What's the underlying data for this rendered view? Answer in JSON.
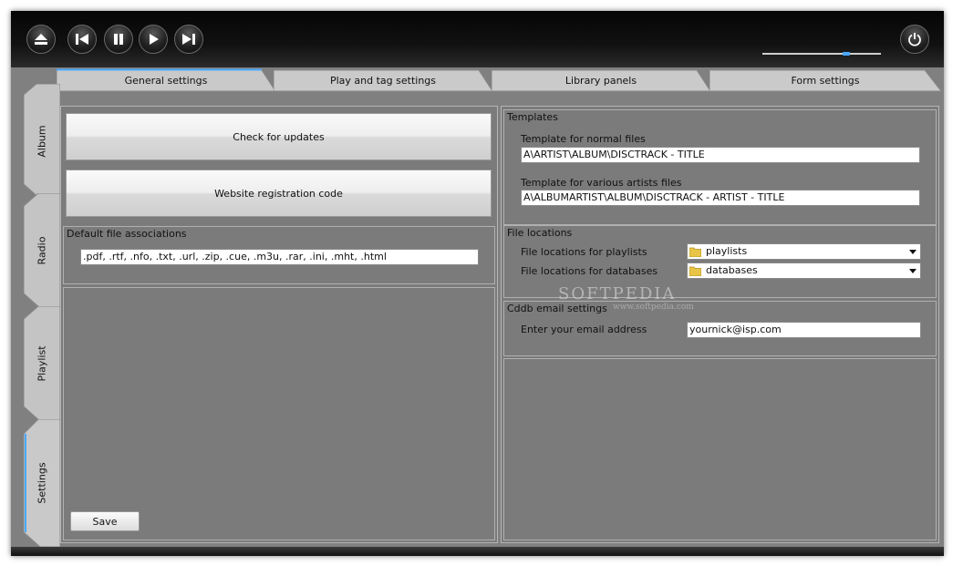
{
  "colors": {
    "accent": "#4aa8ff",
    "chrome": "#0c0c0c",
    "content_bg": "#7b7b7b",
    "button_face": "#ececec"
  },
  "transport": {
    "buttons": [
      {
        "name": "eject",
        "icon": "eject-icon"
      },
      {
        "name": "previous",
        "icon": "skip-back-icon"
      },
      {
        "name": "pause",
        "icon": "pause-icon"
      },
      {
        "name": "play",
        "icon": "play-icon"
      },
      {
        "name": "next",
        "icon": "skip-forward-icon"
      }
    ],
    "power_icon": "power-icon",
    "volume_level": 0.72
  },
  "tabs": [
    {
      "label": "General settings",
      "active": true
    },
    {
      "label": "Play and tag settings",
      "active": false
    },
    {
      "label": "Library panels",
      "active": false
    },
    {
      "label": "Form settings",
      "active": false
    }
  ],
  "side_tabs": [
    {
      "label": "Album",
      "active": false
    },
    {
      "label": "Radio",
      "active": false
    },
    {
      "label": "Playlist",
      "active": false
    },
    {
      "label": "Settings",
      "active": true
    }
  ],
  "general": {
    "check_updates_label": "Check for updates",
    "registration_label": "Website registration code",
    "file_assoc": {
      "title": "Default file associations",
      "value": ".pdf, .rtf, .nfo, .txt, .url, .zip, .cue, .m3u, .rar, .ini, .mht, .html"
    },
    "save_label": "Save"
  },
  "templates": {
    "title": "Templates",
    "normal_label": "Template for normal files",
    "normal_value": "A\\ARTIST\\ALBUM\\DISCTRACK - TITLE",
    "various_label": "Template for various artists files",
    "various_value": "A\\ALBUMARTIST\\ALBUM\\DISCTRACK - ARTIST - TITLE"
  },
  "file_locations": {
    "title": "File locations",
    "playlists_label": "File locations for playlists",
    "playlists_value": "playlists",
    "databases_label": "File locations for databases",
    "databases_value": "databases"
  },
  "cddb": {
    "title": "Cddb email settings",
    "email_label": "Enter your email address",
    "email_value": "yournick@isp.com"
  },
  "watermark": {
    "text": "SOFTPEDIA",
    "sub": "www.softpedia.com"
  }
}
